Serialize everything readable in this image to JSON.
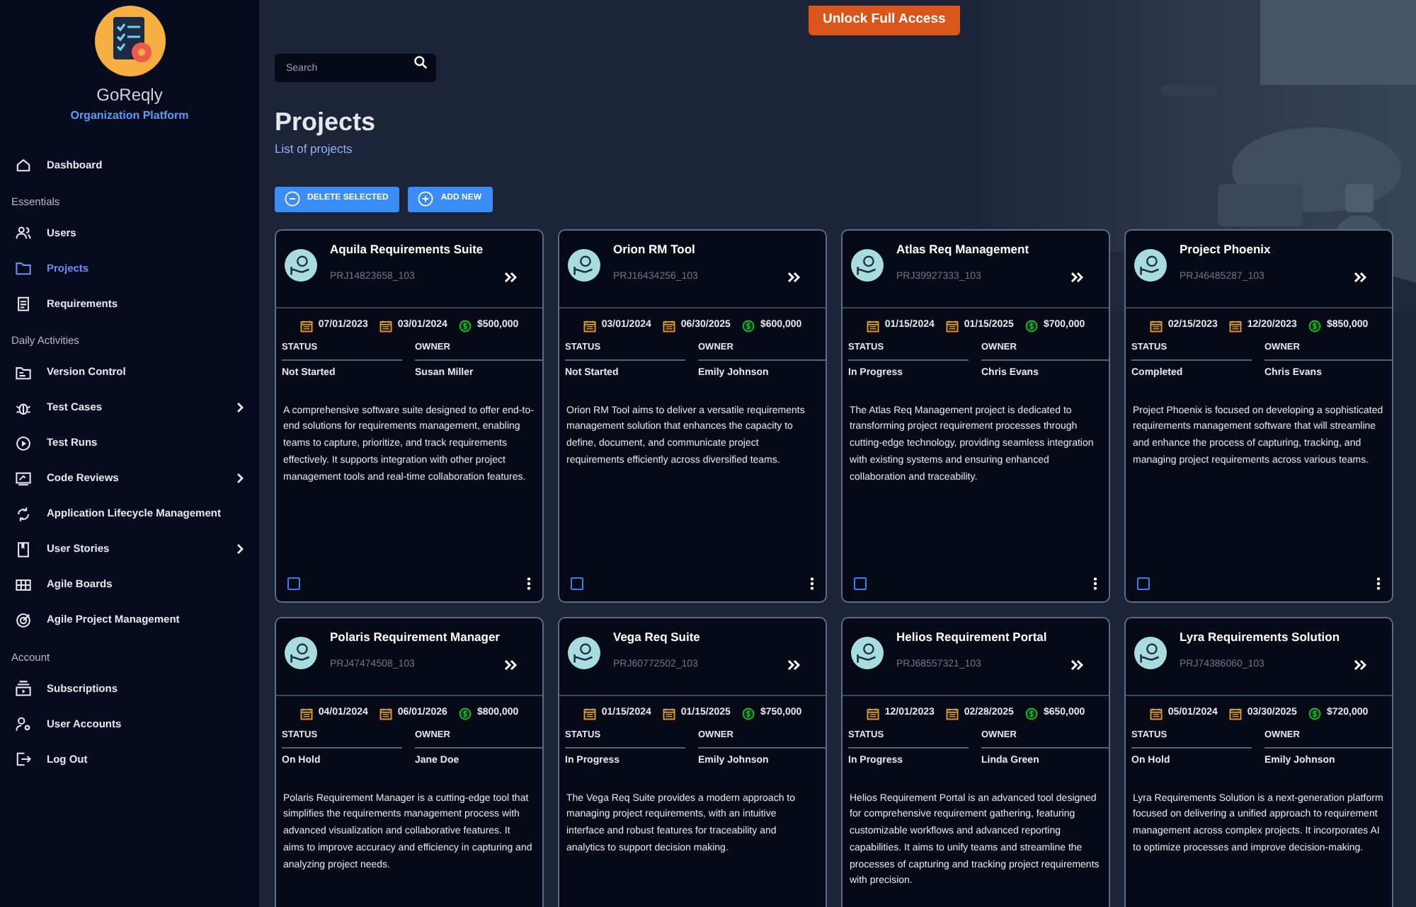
{
  "app": {
    "name": "GoReqly",
    "subtitle": "Organization Platform"
  },
  "sidebar": {
    "sections": [
      {
        "items": [
          {
            "label": "Dashboard",
            "selected": false,
            "expandable": false
          }
        ]
      },
      {
        "heading": "Essentials",
        "items": [
          {
            "label": "Users",
            "selected": false,
            "expandable": false
          },
          {
            "label": "Projects",
            "selected": true,
            "expandable": false
          },
          {
            "label": "Requirements",
            "selected": false,
            "expandable": false
          }
        ]
      },
      {
        "heading": "Daily Activities",
        "items": [
          {
            "label": "Version Control",
            "selected": false,
            "expandable": false
          },
          {
            "label": "Test Cases",
            "selected": false,
            "expandable": true
          },
          {
            "label": "Test Runs",
            "selected": false,
            "expandable": false
          },
          {
            "label": "Code Reviews",
            "selected": false,
            "expandable": true
          },
          {
            "label": "Application Lifecycle Management",
            "selected": false,
            "expandable": false
          },
          {
            "label": "User Stories",
            "selected": false,
            "expandable": true
          },
          {
            "label": "Agile Boards",
            "selected": false,
            "expandable": false
          },
          {
            "label": "Agile Project Management",
            "selected": false,
            "expandable": false
          }
        ]
      },
      {
        "heading": "Account",
        "items": [
          {
            "label": "Subscriptions",
            "selected": false,
            "expandable": false
          },
          {
            "label": "User Accounts",
            "selected": false,
            "expandable": false
          },
          {
            "label": "Log Out",
            "selected": false,
            "expandable": false
          }
        ]
      }
    ]
  },
  "unlock_button": "Unlock Full Access",
  "search": {
    "placeholder": "Search"
  },
  "page": {
    "title": "Projects",
    "subtitle": "List of projects"
  },
  "toolbar": [
    {
      "label": "DELETE SELECTED",
      "kind": "remove"
    },
    {
      "label": "ADD NEW",
      "kind": "add"
    }
  ],
  "projects": [
    {
      "name": "Aquila Requirements Suite",
      "code": "PRJ14823658_103",
      "start": "07/01/2023",
      "end": "03/01/2024",
      "budget": "$500,000",
      "status_label": "STATUS",
      "status": "Not Started",
      "owner_label": "OWNER",
      "owner": "Susan Miller",
      "description": "A comprehensive software suite designed to offer end-to-end solutions for requirements management, enabling teams to capture, prioritize, and track requirements effectively. It supports integration with other project management tools and real-time collaboration features.",
      "selected": false
    },
    {
      "name": "Orion RM Tool",
      "code": "PRJ16434256_103",
      "start": "03/01/2024",
      "end": "06/30/2025",
      "budget": "$600,000",
      "status_label": "STATUS",
      "status": "Not Started",
      "owner_label": "OWNER",
      "owner": "Emily Johnson",
      "description": "Orion RM Tool aims to deliver a versatile requirements management solution that enhances the capacity to define, document, and communicate project requirements efficiently across diversified teams.",
      "selected": false
    },
    {
      "name": "Atlas Req Management",
      "code": "PRJ39927333_103",
      "start": "01/15/2024",
      "end": "01/15/2025",
      "budget": "$700,000",
      "status_label": "STATUS",
      "status": "In Progress",
      "owner_label": "OWNER",
      "owner": "Chris Evans",
      "description": "The Atlas Req Management project is dedicated to transforming project requirement processes through cutting-edge technology, providing seamless integration with existing systems and ensuring enhanced collaboration and traceability.",
      "selected": false
    },
    {
      "name": "Project Phoenix",
      "code": "PRJ46485287_103",
      "start": "02/15/2023",
      "end": "12/20/2023",
      "budget": "$850,000",
      "status_label": "STATUS",
      "status": "Completed",
      "owner_label": "OWNER",
      "owner": "Chris Evans",
      "description": "Project Phoenix is focused on developing a sophisticated requirements management software that will streamline and enhance the process of capturing, tracking, and managing project requirements across various teams.",
      "selected": false
    },
    {
      "name": "Polaris Requirement Manager",
      "code": "PRJ47474508_103",
      "start": "04/01/2024",
      "end": "06/01/2026",
      "budget": "$800,000",
      "status_label": "STATUS",
      "status": "On Hold",
      "owner_label": "OWNER",
      "owner": "Jane Doe",
      "description": "Polaris Requirement Manager is a cutting-edge tool that simplifies the requirements management process with advanced visualization and collaborative features. It aims to improve accuracy and efficiency in capturing and analyzing project needs."
    },
    {
      "name": "Vega Req Suite",
      "code": "PRJ60772502_103",
      "start": "01/15/2024",
      "end": "01/15/2025",
      "budget": "$750,000",
      "status_label": "STATUS",
      "status": "In Progress",
      "owner_label": "OWNER",
      "owner": "Emily Johnson",
      "description": "The Vega Req Suite provides a modern approach to managing project requirements, with an intuitive interface and robust features for traceability and analytics to support decision making."
    },
    {
      "name": "Helios Requirement Portal",
      "code": "PRJ68557321_103",
      "start": "12/01/2023",
      "end": "02/28/2025",
      "budget": "$650,000",
      "status_label": "STATUS",
      "status": "In Progress",
      "owner_label": "OWNER",
      "owner": "Linda Green",
      "description": "Helios Requirement Portal is an advanced tool designed for comprehensive requirement gathering, featuring customizable workflows and advanced reporting capabilities. It aims to unify teams and streamline the processes of capturing and tracking project requirements with precision."
    },
    {
      "name": "Lyra Requirements Solution",
      "code": "PRJ74386060_103",
      "start": "05/01/2024",
      "end": "03/30/2025",
      "budget": "$720,000",
      "status_label": "STATUS",
      "status": "On Hold",
      "owner_label": "OWNER",
      "owner": "Emily Johnson",
      "description": "Lyra Requirements Solution is a next-generation platform focused on delivering a unified approach to requirement management across complex projects. It incorporates AI to optimize processes and improve decision-making."
    }
  ]
}
